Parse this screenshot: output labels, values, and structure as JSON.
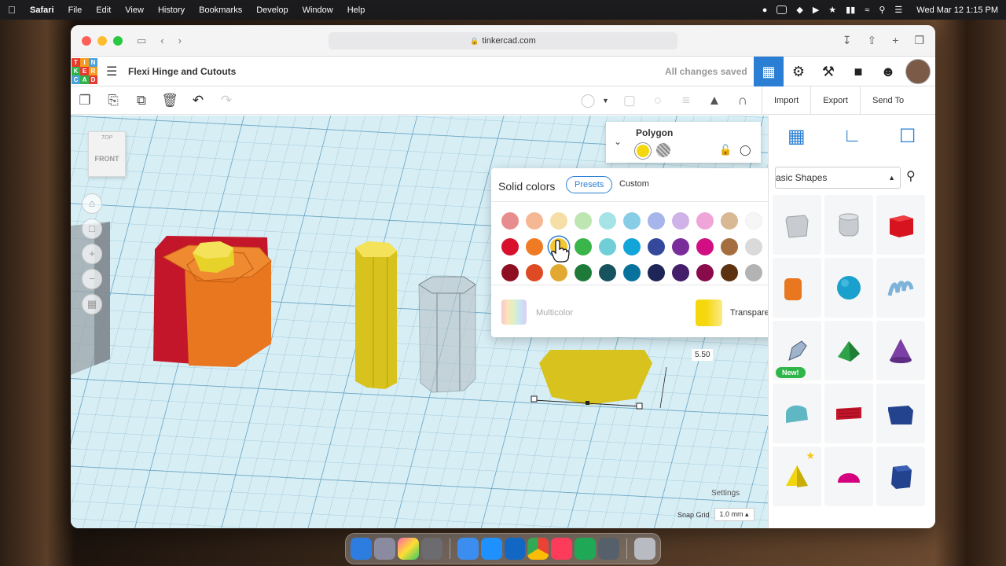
{
  "menubar": {
    "app": "Safari",
    "items": [
      "File",
      "Edit",
      "View",
      "History",
      "Bookmarks",
      "Develop",
      "Window",
      "Help"
    ],
    "clock": "Wed Mar 12  1:15 PM"
  },
  "browser": {
    "url": "tinkercad.com"
  },
  "header": {
    "logo_letters": [
      "T",
      "I",
      "N",
      "K",
      "E",
      "R",
      "C",
      "A",
      "D"
    ],
    "title": "Flexi Hinge and Cutouts",
    "save_status": "All changes saved"
  },
  "toolbar": {
    "import_label": "Import",
    "export_label": "Export",
    "sendto_label": "Send To"
  },
  "viewcube": {
    "top": "TOP",
    "front": "FRONT"
  },
  "inspector": {
    "shape_name": "Polygon"
  },
  "color_popup": {
    "title": "Solid colors",
    "tab_presets": "Presets",
    "tab_custom": "Custom",
    "rows": [
      [
        "#e88d8d",
        "#f6b894",
        "#f6dfa6",
        "#bde6b2",
        "#a4e4e7",
        "#87cde6",
        "#a6b5ea",
        "#cfb3e8",
        "#efa5d8",
        "#d9b894",
        "#f6f6f6",
        "#a4a5a6"
      ],
      [
        "#d8102d",
        "#ef7c24",
        "#f3c731",
        "#3ab549",
        "#70cfd6",
        "#12a5d8",
        "#34489c",
        "#7b2c9b",
        "#d10f83",
        "#a56e3f",
        "#dadada",
        "#6b6c6d"
      ],
      [
        "#8f0f22",
        "#de4a23",
        "#e1a92f",
        "#1e7a39",
        "#17535e",
        "#08719c",
        "#1d2657",
        "#451e6b",
        "#8a0b4c",
        "#5c3211",
        "#b3b3b3",
        "#2a2a2a"
      ]
    ],
    "multicolor_label": "Multicolor",
    "transparent_label": "Transparent"
  },
  "workplane": {
    "dimension": "5.50",
    "settings_label": "Settings",
    "snap_label": "Snap Grid",
    "snap_value": "1.0 mm"
  },
  "shapes_panel": {
    "category": "Basic Shapes",
    "new_badge": "New!"
  }
}
